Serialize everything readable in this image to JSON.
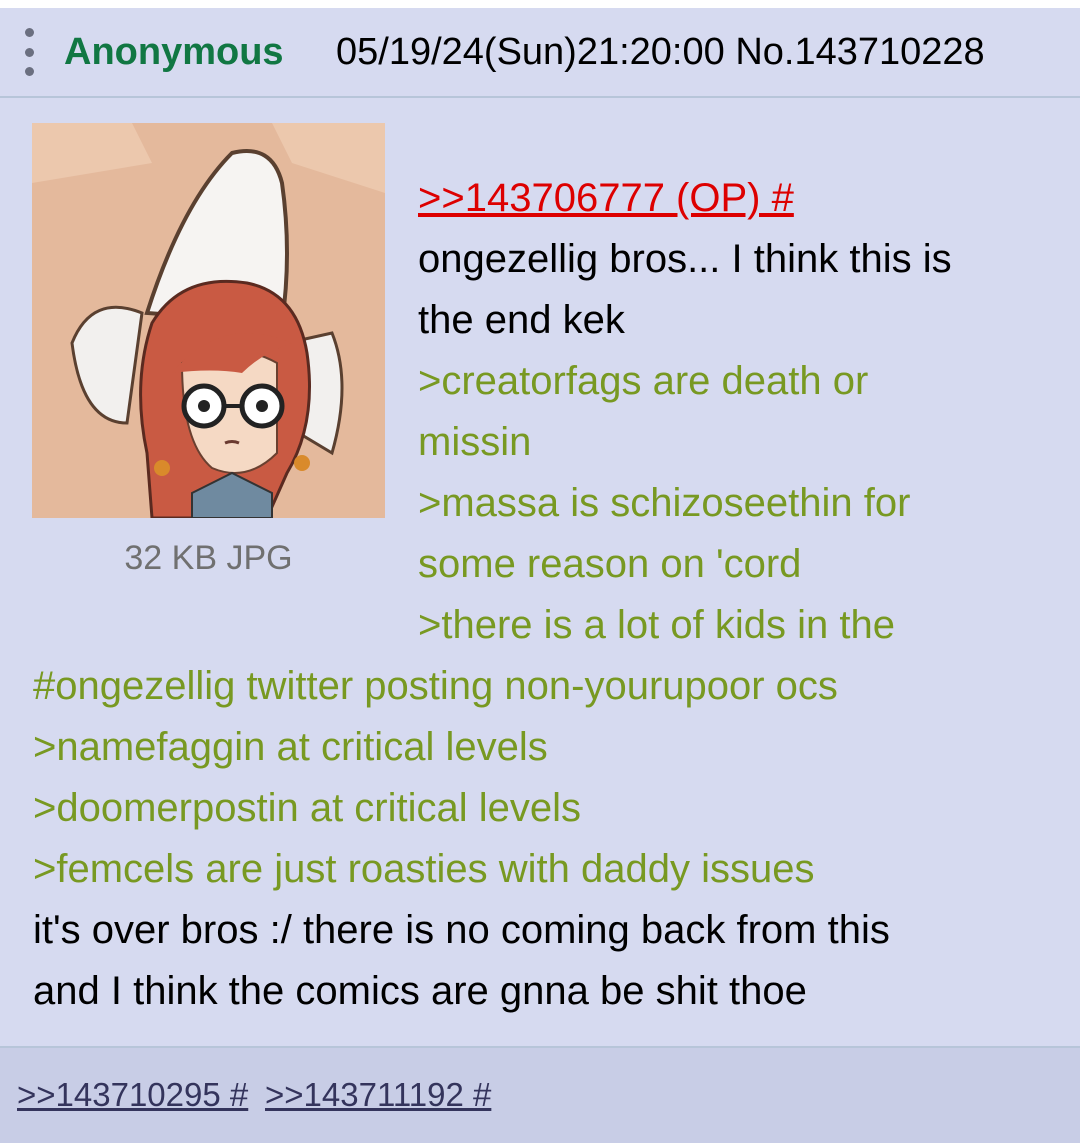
{
  "post": {
    "name": "Anonymous",
    "datetime": "05/19/24(Sun)21:20:00",
    "number": "No.143710228",
    "file_info": "32 KB JPG",
    "quote_link": ">>143706777 (OP) #",
    "lines": [
      "ongezellig bros... I think this is",
      "the end kek",
      ">creatorfags are death or",
      "missin",
      ">massa is schizoseethin for",
      "some reason on 'cord",
      ">there is a lot of kids in the",
      "#ongezellig twitter posting non-yourupoor ocs",
      ">namefaggin at critical levels",
      ">doomerpostin at critical levels",
      ">femcels are just roasties with daddy issues",
      "it's over bros :/ there is no coming back from this",
      "and I think the comics are gnna be shit thoe"
    ],
    "backlinks": [
      ">>143710295 #",
      ">>143711192 #"
    ]
  },
  "icons": {
    "menu": "vertical-ellipsis-icon"
  },
  "colors": {
    "post_bg": "#d6daf0",
    "footer_bg": "#c8cde6",
    "name": "#117743",
    "greentext": "#789922",
    "quotelink": "#dd0000",
    "backlink": "#34345c"
  }
}
